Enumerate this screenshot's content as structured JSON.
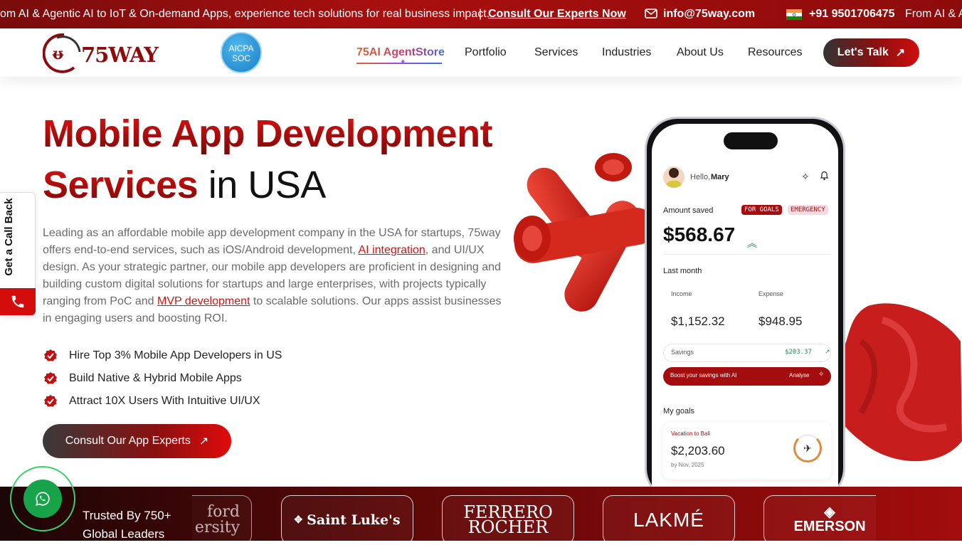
{
  "topbar": {
    "marquee_text": "om AI & Agentic AI to IoT & On-demand Apps, experience tech solutions for real business impact.",
    "separator": "|",
    "cta": "Consult Our Experts Now",
    "email": "info@75way.com",
    "phone": "+91 9501706475",
    "marquee_repeat": "From AI & A"
  },
  "header": {
    "logo_text": "75WAY",
    "badge_line1": "AICPA",
    "badge_line2": "SOC",
    "nav": [
      "75AI AgentStore",
      "Portfolio",
      "Services",
      "Industries",
      "About Us",
      "Resources"
    ],
    "cta": "Let's Talk"
  },
  "hero": {
    "title_red_1": "Mobile App Development",
    "title_red_2": "Services",
    "title_plain": " in USA",
    "intro_1": "Leading as an affordable mobile app development company in the USA for startups, 75way offers end-to-end services, such as iOS/Android development, ",
    "intro_link_1": "AI integration",
    "intro_2": ", and UI/UX design. As your strategic partner, our mobile app developers are proficient in designing and building custom digital solutions for startups and large enterprises, with projects typically ranging from PoC and ",
    "intro_link_2": "MVP development",
    "intro_3": " to scalable solutions. Our apps assist businesses in engaging users and boosting ROI.",
    "bullets": [
      "Hire Top 3% Mobile App Developers in US",
      "Build Native & Hybrid Mobile Apps",
      "Attract 10X Users With Intuitive UI/UX"
    ],
    "cta": "Consult Our App Experts"
  },
  "callback": {
    "label": "Get a Call Back"
  },
  "phone_app": {
    "greeting": "Hello, ",
    "user": "Mary",
    "amount_label": "Amount saved",
    "tag_goals": "FOR GOALS",
    "tag_emergency": "EMERGENCY",
    "amount": "$568.67",
    "period": "Last month",
    "income_label": "Income",
    "income": "$1,152.32",
    "expense_label": "Expense",
    "expense": "$948.95",
    "savings_label": "Savings",
    "savings_value": "$203.37",
    "boost_text": "Boost your savings with AI",
    "analyse": "Analyse",
    "goals_title": "My goals",
    "goal_name": "Vacation to Bali",
    "goal_amount": "$2,203.60",
    "goal_date": "by Nov, 2025"
  },
  "trusted": {
    "line1": "Trusted By 750+",
    "line2": "Global Leaders",
    "logos": [
      "ford\nersity",
      "Saint Luke's",
      "FERRERO\nROCHER",
      "LAKMÉ",
      "EMERSON"
    ]
  },
  "colors": {
    "brand_red": "#c40e0e",
    "dark_red": "#7a0c0c",
    "whatsapp": "#16a34a"
  }
}
